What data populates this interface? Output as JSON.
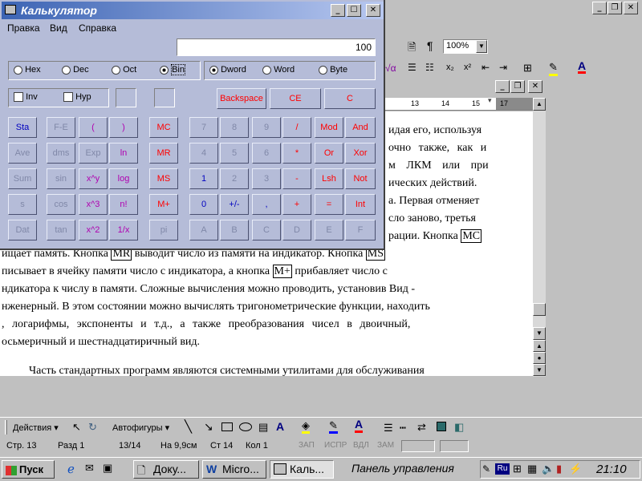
{
  "word": {
    "zoom": "100%",
    "doc_lines": [
      "идая его, используя",
      "очно также, как и",
      "м ЛКМ или при",
      "ических действий.",
      "а. Первая отменяет",
      "сло заново, третья",
      "рации. Кнопка",
      "ищает память. Кнопка",
      "выводит число из памяти на индикатор. Кнопка",
      "писывает в ячейку памяти число с индикатора, а кнопка",
      "прибавляет число с",
      "ндикатора к числу в памяти. Сложные вычисления можно проводить, установив Вид -",
      "нженерный. В этом состоянии можно вычислять тригонометрические функции, находить",
      ", логарифмы, экспоненты и т.д., а также преобразования чисел в двоичный,",
      "осьмеричный и шестнадцатиричный вид.",
      "Часть стандартных программ являются системными утилитами для обслуживания"
    ],
    "boxed": {
      "mc": "MC",
      "mr": "MR",
      "ms": "MS",
      "mplus": "M+"
    },
    "ruler": [
      "13",
      "14",
      "15",
      "16",
      "17"
    ],
    "drawing_bar": {
      "actions": "Действия",
      "autoshapes": "Автофигуры"
    },
    "status": {
      "page": "Стр. 13",
      "section": "Разд 1",
      "pages": "13/14",
      "at": "На 9,9см",
      "line": "Ст 14",
      "col": "Кол 1",
      "rec": "ЗАП",
      "trk": "ИСПР",
      "ext": "ВДЛ",
      "ovr": "ЗАМ"
    }
  },
  "calculator": {
    "title": "Калькулятор",
    "menu": [
      "Правка",
      "Вид",
      "Справка"
    ],
    "display": "100",
    "radix": [
      "Hex",
      "Dec",
      "Oct",
      "Bin"
    ],
    "size": [
      "Dword",
      "Word",
      "Byte"
    ],
    "checks": [
      "Inv",
      "Hyp"
    ],
    "top_buttons": [
      "Backspace",
      "CE",
      "C"
    ],
    "rows": [
      [
        "Sta",
        "F-E",
        "(",
        ")",
        "MC",
        "7",
        "8",
        "9",
        "/",
        "Mod",
        "And"
      ],
      [
        "Ave",
        "dms",
        "Exp",
        "ln",
        "MR",
        "4",
        "5",
        "6",
        "*",
        "Or",
        "Xor"
      ],
      [
        "Sum",
        "sin",
        "x^y",
        "log",
        "MS",
        "1",
        "2",
        "3",
        "-",
        "Lsh",
        "Not"
      ],
      [
        "s",
        "cos",
        "x^3",
        "n!",
        "M+",
        "0",
        "+/-",
        ",",
        "+",
        "=",
        "Int"
      ],
      [
        "Dat",
        "tan",
        "x^2",
        "1/x",
        "pi",
        "A",
        "B",
        "C",
        "D",
        "E",
        "F"
      ]
    ],
    "row_colors": [
      [
        "blue",
        "gray",
        "purple",
        "purple",
        "red",
        "gray",
        "gray",
        "gray",
        "red",
        "red",
        "red"
      ],
      [
        "gray",
        "gray",
        "gray",
        "purple",
        "red",
        "gray",
        "gray",
        "gray",
        "red",
        "red",
        "red"
      ],
      [
        "gray",
        "gray",
        "purple",
        "purple",
        "red",
        "blue",
        "gray",
        "gray",
        "red",
        "red",
        "red"
      ],
      [
        "gray",
        "gray",
        "purple",
        "purple",
        "red",
        "blue",
        "blue",
        "blue",
        "red",
        "red",
        "red"
      ],
      [
        "gray",
        "gray",
        "purple",
        "purple",
        "gray",
        "gray",
        "gray",
        "gray",
        "gray",
        "gray",
        "gray"
      ]
    ]
  },
  "taskbar": {
    "start": "Пуск",
    "tasks": [
      "Доку...",
      "Micro...",
      "Каль..."
    ],
    "panel": "Панель управления",
    "lang": "Ru",
    "clock": "21:10"
  }
}
